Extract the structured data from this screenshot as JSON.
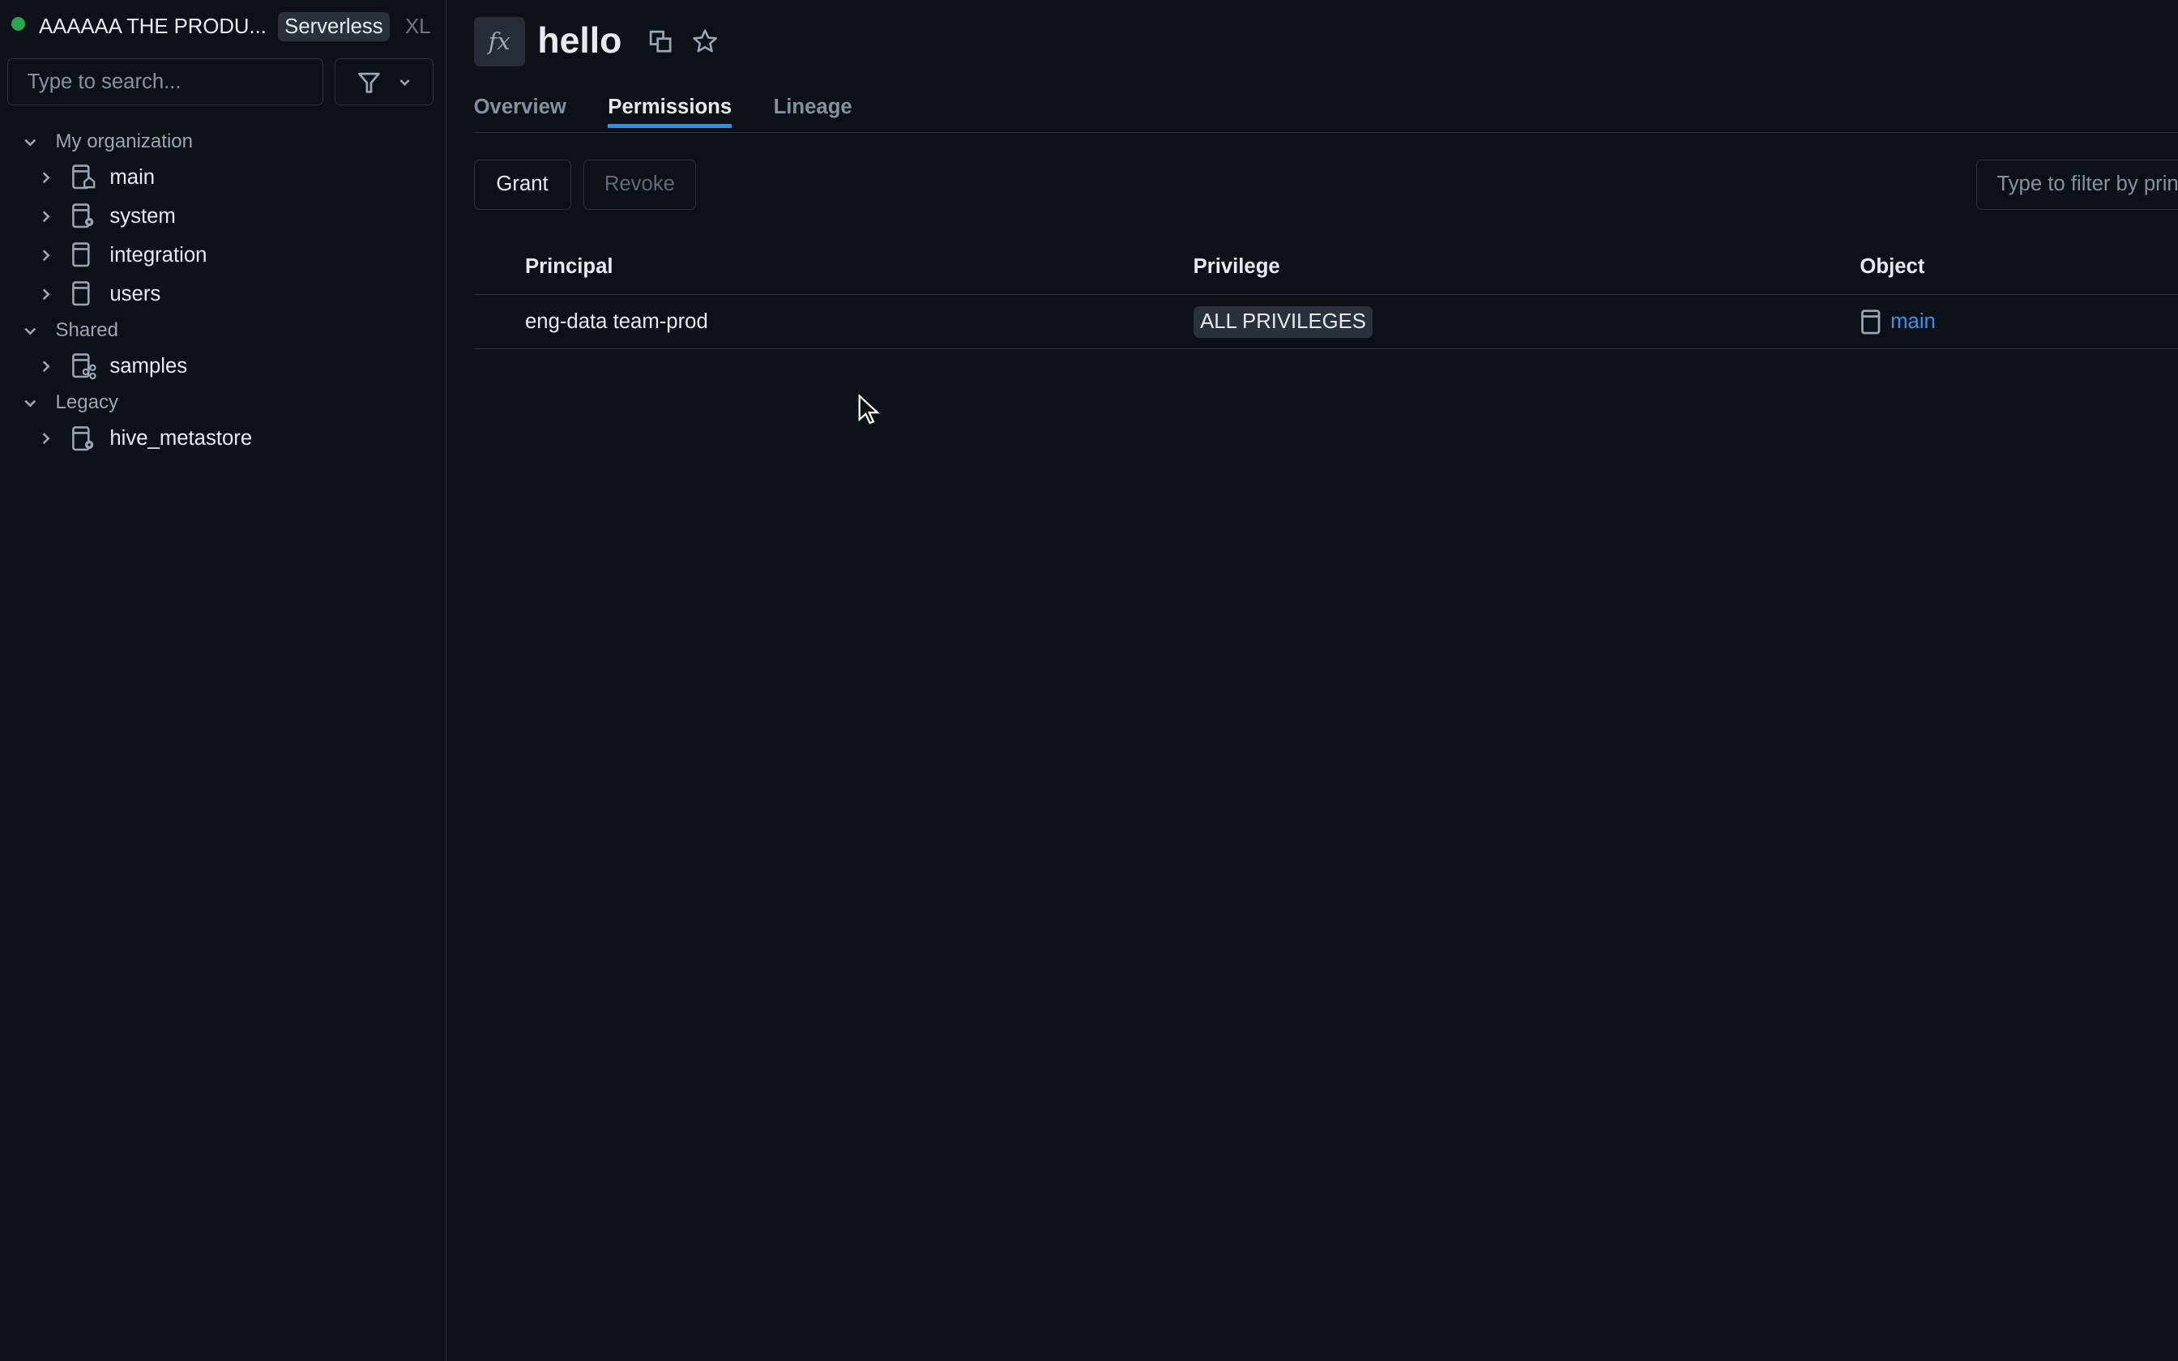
{
  "sidebar": {
    "workspace": {
      "name": "AAAAAA THE PRODU...",
      "badge": "Serverless",
      "size": "XL",
      "status_color": "#2ea44f"
    },
    "search_placeholder": "Type to search...",
    "sections": [
      {
        "label": "My organization",
        "items": [
          {
            "label": "main",
            "icon": "catalog-home-icon"
          },
          {
            "label": "system",
            "icon": "catalog-gear-icon"
          },
          {
            "label": "integration",
            "icon": "catalog-icon"
          },
          {
            "label": "users",
            "icon": "catalog-icon"
          }
        ]
      },
      {
        "label": "Shared",
        "items": [
          {
            "label": "samples",
            "icon": "catalog-share-icon"
          }
        ]
      },
      {
        "label": "Legacy",
        "items": [
          {
            "label": "hive_metastore",
            "icon": "catalog-gear-icon"
          }
        ]
      }
    ]
  },
  "header": {
    "title": "hello",
    "icon": "function-icon"
  },
  "tabs": [
    {
      "label": "Overview"
    },
    {
      "label": "Permissions",
      "active": true
    },
    {
      "label": "Lineage"
    }
  ],
  "toolbar": {
    "grant": "Grant",
    "revoke": "Revoke",
    "filter_placeholder": "Type to filter by principal"
  },
  "table": {
    "columns": [
      "Principal",
      "Privilege",
      "Object"
    ],
    "rows": [
      {
        "principal": "eng-data team-prod",
        "privilege": "ALL PRIVILEGES",
        "object": "main"
      }
    ]
  },
  "colors": {
    "accent": "#2f8fe8",
    "link": "#3b94e8",
    "background": "#0c1117"
  }
}
